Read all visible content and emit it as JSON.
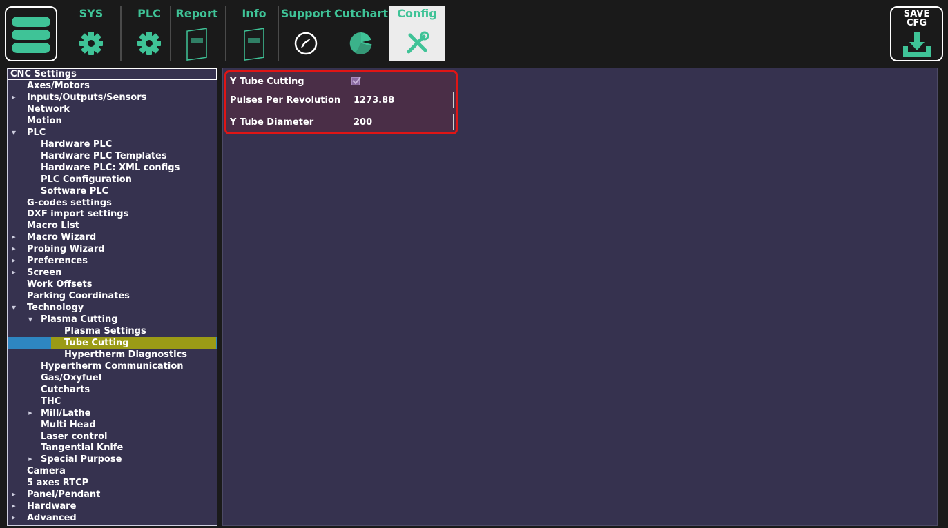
{
  "toolbar": {
    "tabs": [
      {
        "id": "sys",
        "label": "SYS",
        "icon": "gear-icon"
      },
      {
        "id": "plc",
        "label": "PLC",
        "icon": "gear-icon"
      },
      {
        "id": "report",
        "label": "Report",
        "icon": "document-icon"
      },
      {
        "id": "info",
        "label": "Info",
        "icon": "document-icon"
      },
      {
        "id": "support",
        "label": "Support",
        "icon": "phone-icon"
      },
      {
        "id": "cutchart",
        "label": "Cutchart",
        "icon": "pie-chart-icon"
      },
      {
        "id": "config",
        "label": "Config",
        "icon": "tools-icon",
        "active": true
      }
    ],
    "save_label": "SAVE\nCFG"
  },
  "tree": {
    "header": "CNC Settings",
    "items": [
      {
        "label": "Axes/Motors",
        "level": 1,
        "arrow": ""
      },
      {
        "label": "Inputs/Outputs/Sensors",
        "level": 1,
        "arrow": "collapsed"
      },
      {
        "label": "Network",
        "level": 1,
        "arrow": ""
      },
      {
        "label": "Motion",
        "level": 1,
        "arrow": ""
      },
      {
        "label": "PLC",
        "level": 1,
        "arrow": "expanded"
      },
      {
        "label": "Hardware PLC",
        "level": 2,
        "arrow": ""
      },
      {
        "label": "Hardware PLC Templates",
        "level": 2,
        "arrow": ""
      },
      {
        "label": "Hardware PLC: XML configs",
        "level": 2,
        "arrow": ""
      },
      {
        "label": "PLC Configuration",
        "level": 2,
        "arrow": ""
      },
      {
        "label": "Software PLC",
        "level": 2,
        "arrow": ""
      },
      {
        "label": "G-codes settings",
        "level": 1,
        "arrow": ""
      },
      {
        "label": "DXF import settings",
        "level": 1,
        "arrow": ""
      },
      {
        "label": "Macro List",
        "level": 1,
        "arrow": ""
      },
      {
        "label": "Macro Wizard",
        "level": 1,
        "arrow": "collapsed"
      },
      {
        "label": "Probing Wizard",
        "level": 1,
        "arrow": "collapsed"
      },
      {
        "label": "Preferences",
        "level": 1,
        "arrow": "collapsed"
      },
      {
        "label": "Screen",
        "level": 1,
        "arrow": "collapsed"
      },
      {
        "label": "Work Offsets",
        "level": 1,
        "arrow": ""
      },
      {
        "label": "Parking Coordinates",
        "level": 1,
        "arrow": ""
      },
      {
        "label": "Technology",
        "level": 1,
        "arrow": "expanded"
      },
      {
        "label": "Plasma Cutting",
        "level": 2,
        "arrow": "expanded"
      },
      {
        "label": "Plasma Settings",
        "level": 3,
        "arrow": ""
      },
      {
        "label": "Tube Cutting",
        "level": 3,
        "arrow": "",
        "selected": true
      },
      {
        "label": "Hypertherm Diagnostics",
        "level": 3,
        "arrow": ""
      },
      {
        "label": "Hypertherm Communication",
        "level": 2,
        "arrow": ""
      },
      {
        "label": "Gas/Oxyfuel",
        "level": 2,
        "arrow": ""
      },
      {
        "label": "Cutcharts",
        "level": 2,
        "arrow": ""
      },
      {
        "label": "THC",
        "level": 2,
        "arrow": ""
      },
      {
        "label": "Mill/Lathe",
        "level": 2,
        "arrow": "collapsed"
      },
      {
        "label": "Multi Head",
        "level": 2,
        "arrow": ""
      },
      {
        "label": "Laser control",
        "level": 2,
        "arrow": ""
      },
      {
        "label": "Tangential Knife",
        "level": 2,
        "arrow": ""
      },
      {
        "label": "Special Purpose",
        "level": 2,
        "arrow": "collapsed"
      },
      {
        "label": "Camera",
        "level": 1,
        "arrow": ""
      },
      {
        "label": "5 axes RTCP",
        "level": 1,
        "arrow": ""
      },
      {
        "label": "Panel/Pendant",
        "level": 1,
        "arrow": "collapsed"
      },
      {
        "label": "Hardware",
        "level": 1,
        "arrow": "collapsed"
      },
      {
        "label": "Advanced",
        "level": 1,
        "arrow": "collapsed"
      }
    ]
  },
  "settings": {
    "y_tube_cutting_label": "Y Tube Cutting",
    "y_tube_cutting_checked": true,
    "pulses_label": "Pulses Per Revolution",
    "pulses_value": "1273.88",
    "diameter_label": "Y Tube Diameter",
    "diameter_value": "200"
  },
  "colors": {
    "accent": "#3fc397",
    "panel_bg": "#36324f",
    "selected_blue": "#2e86c1",
    "selected_olive": "#9b9b16",
    "highlight_border": "#e01515"
  }
}
